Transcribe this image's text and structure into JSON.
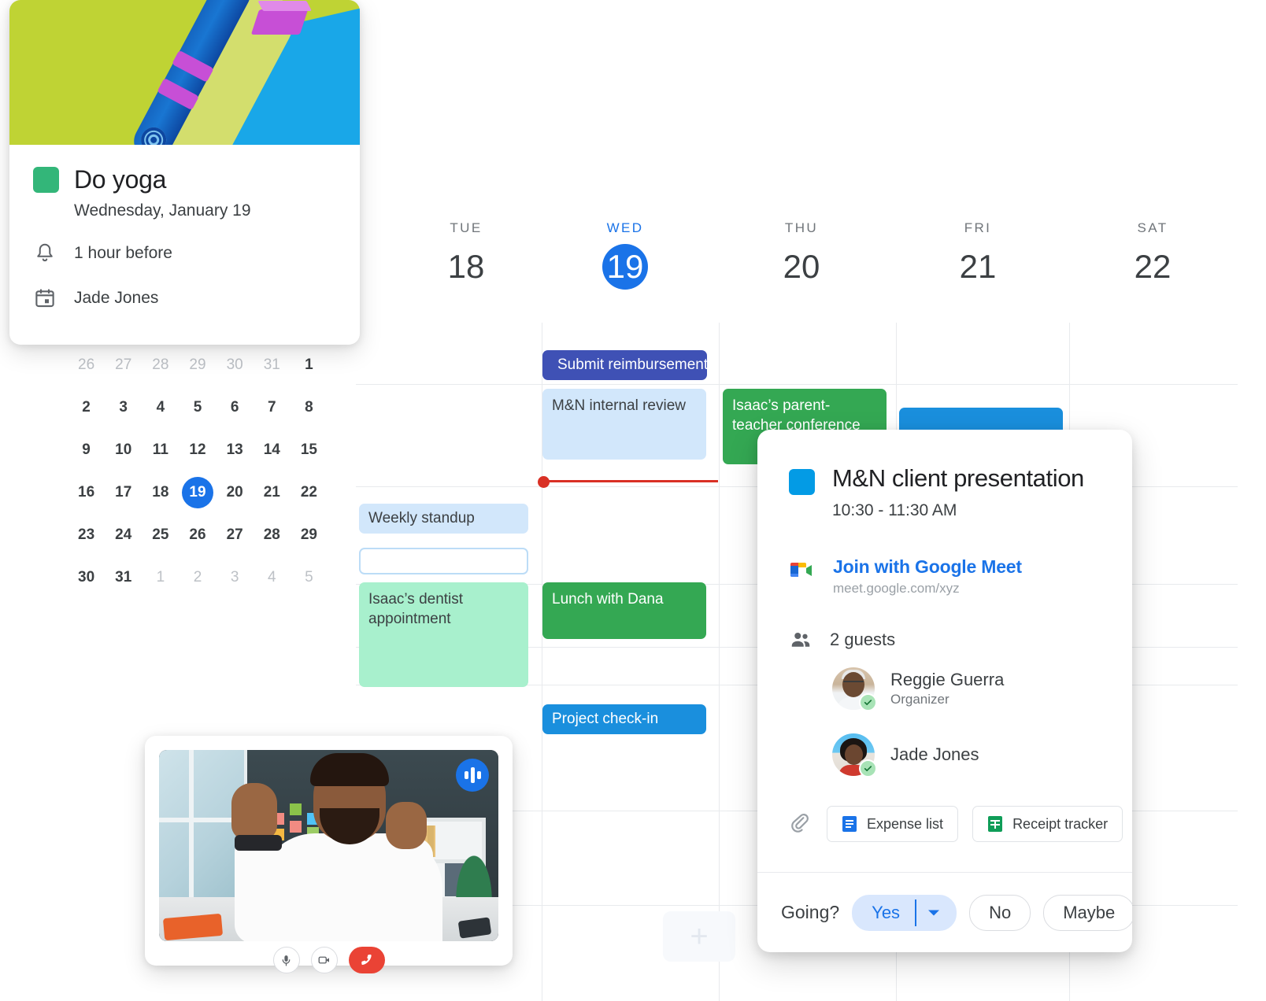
{
  "yoga_card": {
    "image_alt": "yoga-mat-illustration",
    "title": "Do yoga",
    "date": "Wednesday, January 19",
    "swatch_color": "#33b679",
    "reminder": {
      "icon": "bell-icon",
      "text": "1 hour before"
    },
    "calendar": {
      "icon": "calendar-icon",
      "text": "Jade Jones"
    }
  },
  "mini_calendar": {
    "weeks": [
      [
        {
          "d": "26",
          "o": true
        },
        {
          "d": "27",
          "o": true
        },
        {
          "d": "28",
          "o": true
        },
        {
          "d": "29",
          "o": true
        },
        {
          "d": "30",
          "o": true
        },
        {
          "d": "31",
          "o": true
        },
        {
          "d": "1",
          "o": false
        }
      ],
      [
        {
          "d": "2",
          "o": false
        },
        {
          "d": "3",
          "o": false
        },
        {
          "d": "4",
          "o": false
        },
        {
          "d": "5",
          "o": false
        },
        {
          "d": "6",
          "o": false
        },
        {
          "d": "7",
          "o": false
        },
        {
          "d": "8",
          "o": false
        }
      ],
      [
        {
          "d": "9",
          "o": false
        },
        {
          "d": "10",
          "o": false
        },
        {
          "d": "11",
          "o": false
        },
        {
          "d": "12",
          "o": false
        },
        {
          "d": "13",
          "o": false
        },
        {
          "d": "14",
          "o": false
        },
        {
          "d": "15",
          "o": false
        }
      ],
      [
        {
          "d": "16",
          "o": false
        },
        {
          "d": "17",
          "o": false
        },
        {
          "d": "18",
          "o": false
        },
        {
          "d": "19",
          "o": false,
          "sel": true
        },
        {
          "d": "20",
          "o": false
        },
        {
          "d": "21",
          "o": false
        },
        {
          "d": "22",
          "o": false
        }
      ],
      [
        {
          "d": "23",
          "o": false
        },
        {
          "d": "24",
          "o": false
        },
        {
          "d": "25",
          "o": false
        },
        {
          "d": "26",
          "o": false
        },
        {
          "d": "27",
          "o": false
        },
        {
          "d": "28",
          "o": false
        },
        {
          "d": "29",
          "o": false
        }
      ],
      [
        {
          "d": "30",
          "o": false
        },
        {
          "d": "31",
          "o": false
        },
        {
          "d": "1",
          "o": true
        },
        {
          "d": "2",
          "o": true
        },
        {
          "d": "3",
          "o": true
        },
        {
          "d": "4",
          "o": true
        },
        {
          "d": "5",
          "o": true
        }
      ]
    ],
    "selected_color": "#1a73e8"
  },
  "calendar": {
    "days": [
      {
        "name": "TUE",
        "num": "18",
        "today": false
      },
      {
        "name": "WED",
        "num": "19",
        "today": true
      },
      {
        "name": "THU",
        "num": "20",
        "today": false
      },
      {
        "name": "FRI",
        "num": "21",
        "today": false
      },
      {
        "name": "SAT",
        "num": "22",
        "today": false
      }
    ],
    "today_color": "#1a73e8",
    "now_indicator_color": "#d93025",
    "add_button_label": "+",
    "events": [
      {
        "title": "Submit reimbursement",
        "kind": "task",
        "color": "#3f51b5",
        "icon": "task-check-icon"
      },
      {
        "title": "M&N internal review",
        "kind": "block",
        "color": "#d2e7fb"
      },
      {
        "title": "Isaac’s parent-teacher conference",
        "kind": "block",
        "color": "#34a853"
      },
      {
        "title": "",
        "kind": "block",
        "color": "#1a8fdd"
      },
      {
        "title": "Weekly standup",
        "kind": "chip",
        "color": "#d2e7fb"
      },
      {
        "title": "",
        "kind": "outline",
        "color": "#bcdcf7"
      },
      {
        "title": "Isaac’s dentist appointment",
        "kind": "block",
        "color": "#a8f0cd"
      },
      {
        "title": "Lunch with Dana",
        "kind": "block",
        "color": "#34a853"
      },
      {
        "title": "Project check-in",
        "kind": "chip",
        "color": "#1a8fdd"
      }
    ]
  },
  "video_call": {
    "badge_icon": "audio-wave-icon",
    "controls": [
      {
        "name": "microphone-icon",
        "label": "Microphone"
      },
      {
        "name": "camera-icon",
        "label": "Camera"
      },
      {
        "name": "end-call-icon",
        "label": "End call"
      }
    ],
    "end_call_color": "#ea4335"
  },
  "popup": {
    "swatch_color": "#039be5",
    "title": "M&N client presentation",
    "time": "10:30 - 11:30 AM",
    "meet": {
      "icon": "google-meet-icon",
      "link_label": "Join with Google Meet",
      "url": "meet.google.com/xyz",
      "link_color": "#1a73e8"
    },
    "guests_icon": "people-icon",
    "guests_count": "2 guests",
    "guests": [
      {
        "name": "Reggie Guerra",
        "role": "Organizer",
        "status": "accepted"
      },
      {
        "name": "Jade Jones",
        "role": "",
        "status": "accepted"
      }
    ],
    "attachments_icon": "paperclip-icon",
    "attachments": [
      {
        "label": "Expense list",
        "icon": "google-docs-icon",
        "color": "#1a73e8"
      },
      {
        "label": "Receipt tracker",
        "icon": "google-sheets-icon",
        "color": "#0f9d58"
      }
    ],
    "rsvp": {
      "question": "Going?",
      "selected": "Yes",
      "dropdown_icon": "caret-down-icon",
      "options": [
        "Yes",
        "No",
        "Maybe"
      ]
    }
  }
}
